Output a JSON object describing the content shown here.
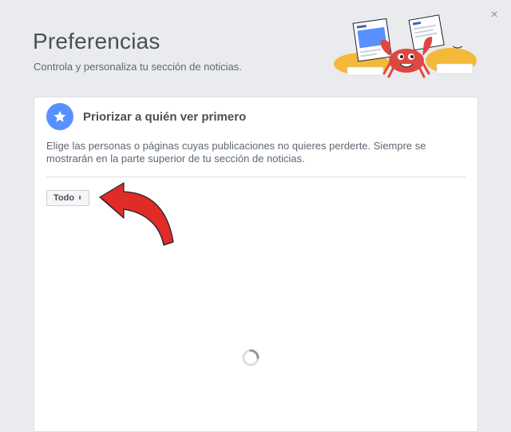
{
  "dialog": {
    "title": "Preferencias",
    "subtitle": "Controla y personaliza tu sección de noticias.",
    "close_symbol": "×"
  },
  "section": {
    "title": "Priorizar a quién ver primero",
    "description": "Elige las personas o páginas cuyas publicaciones no quieres perderte. Siempre se mostrarán en la parte superior de tu sección de noticias.",
    "icon": "star-icon"
  },
  "filter": {
    "label": "Todo",
    "caret": "▲▼"
  },
  "colors": {
    "accent": "#5890ff",
    "arrow": "#e02b27",
    "crab": "#e0473f",
    "sand": "#f4b93a"
  }
}
